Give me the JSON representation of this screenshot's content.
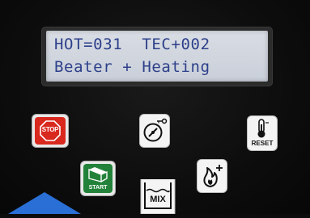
{
  "display": {
    "line1": "HOT=031  TEC+002",
    "line2": "Beater + Heating"
  },
  "buttons": {
    "stop_label": "STOP",
    "start_label": "START",
    "reset_label": "RESET",
    "mix_label": "MIX"
  },
  "colors": {
    "lcd_text": "#2d3f8a",
    "stop": "#d9281e",
    "start": "#22823a",
    "accent_blue": "#2a6fd6"
  }
}
